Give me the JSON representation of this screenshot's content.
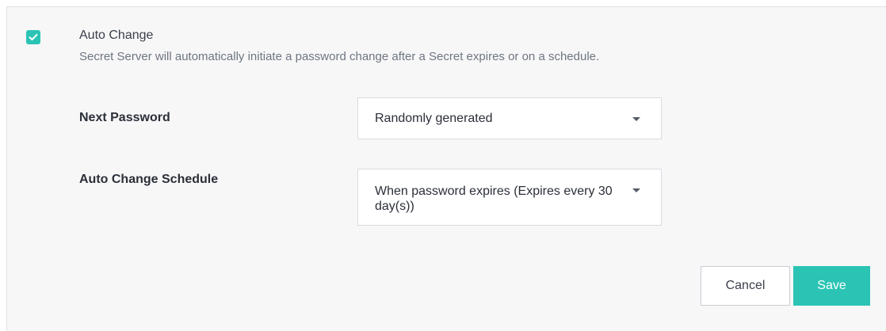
{
  "auto_change": {
    "checked": true,
    "title": "Auto Change",
    "description": "Secret Server will automatically initiate a password change after a Secret expires or on a schedule.",
    "checkbox_icon": "check-icon"
  },
  "fields": {
    "next_password": {
      "label": "Next Password",
      "value": "Randomly generated",
      "dropdown_icon": "caret-down-icon"
    },
    "schedule": {
      "label": "Auto Change Schedule",
      "value": "When password expires (Expires every 30 day(s))",
      "dropdown_icon": "caret-down-icon"
    }
  },
  "actions": {
    "cancel_label": "Cancel",
    "save_label": "Save"
  },
  "colors": {
    "accent": "#2bc4b4",
    "panel_background": "#f7f7f8"
  }
}
